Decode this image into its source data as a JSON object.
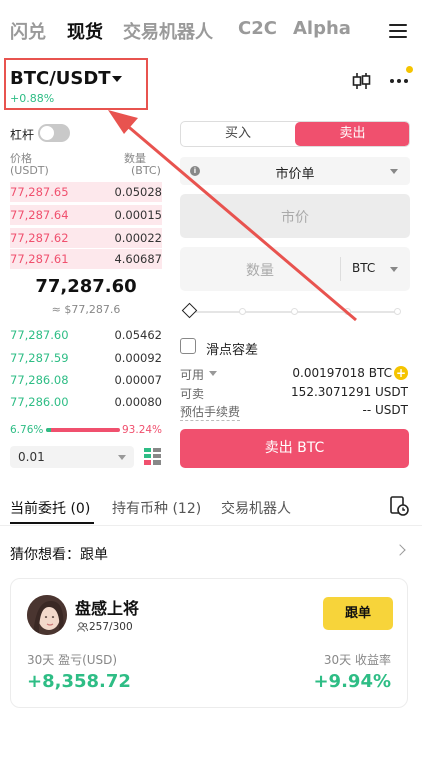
{
  "nav": {
    "tabs": [
      {
        "label": "闪兑"
      },
      {
        "label": "现货"
      },
      {
        "label": "交易机器人"
      },
      {
        "label": "C2C"
      },
      {
        "label": "Alpha"
      }
    ],
    "active_tab": "现货"
  },
  "pair": {
    "name": "BTC/USDT",
    "change": "+0.88%"
  },
  "leverage": {
    "label": "杠杆",
    "enabled": false
  },
  "order_book": {
    "price_header": "价格",
    "price_unit": "(USDT)",
    "qty_header": "数量",
    "qty_unit": "(BTC)",
    "asks": [
      {
        "price": "77,287.65",
        "qty": "0.05028"
      },
      {
        "price": "77,287.64",
        "qty": "0.00015"
      },
      {
        "price": "77,287.62",
        "qty": "0.00022"
      },
      {
        "price": "77,287.61",
        "qty": "4.60687"
      }
    ],
    "last_price": "77,287.60",
    "last_usd": "≈ $77,287.6",
    "bids": [
      {
        "price": "77,287.60",
        "qty": "0.05462"
      },
      {
        "price": "77,287.59",
        "qty": "0.00092"
      },
      {
        "price": "77,286.08",
        "qty": "0.00007"
      },
      {
        "price": "77,286.00",
        "qty": "0.00080"
      }
    ],
    "buy_ratio": "6.76%",
    "sell_ratio": "93.24%",
    "buy_ratio_value": 0.0676,
    "depth": "0.01"
  },
  "trade": {
    "buy_label": "买入",
    "sell_label": "卖出",
    "order_type": "市价单",
    "price_placeholder": "市价",
    "qty_placeholder": "数量",
    "qty_unit": "BTC",
    "slippage_label": "滑点容差",
    "available_label": "可用",
    "available_value": "0.00197018 BTC",
    "sellable_label": "可卖",
    "sellable_value": "152.3071291 USDT",
    "fee_label": "预估手续费",
    "fee_value": "-- USDT",
    "submit_label": "卖出 BTC"
  },
  "lower_tabs": {
    "tabs": [
      {
        "label": "当前委托 (0)"
      },
      {
        "label": "持有币种 (12)"
      },
      {
        "label": "交易机器人"
      }
    ]
  },
  "guess": {
    "label": "猜你想看：跟单"
  },
  "copy_card": {
    "name": "盘感上将",
    "followers": "257/300",
    "follow_label": "跟单",
    "pnl_label": "30天 盈亏(USD)",
    "pnl_value": "+8,358.72",
    "roi_label": "30天 收益率",
    "roi_value": "+9.94%"
  },
  "colors": {
    "buy": "#2ebd85",
    "sell": "#f0506e",
    "annotation": "#e8534f",
    "follow": "#f7d43a"
  }
}
